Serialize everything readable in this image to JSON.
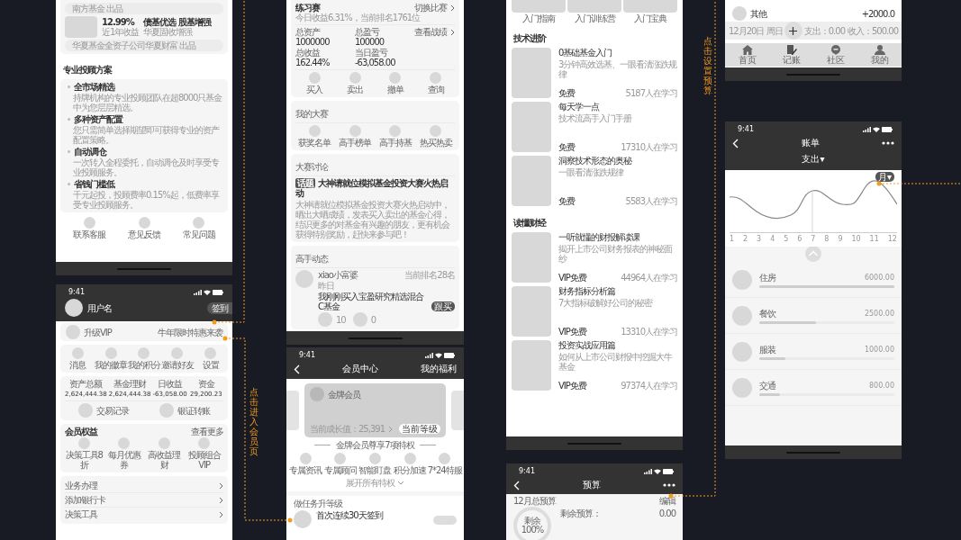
{
  "annotations": [
    {
      "text": "点击进入会员页"
    },
    {
      "text": "点击设置预算"
    }
  ],
  "fund_screen": {
    "issuer_top": "南方基金  出品",
    "fund": {
      "return": "12.99%",
      "return_label": "近1年收益",
      "name": "债基优选 股基增强",
      "subtitle": "华夏固收增强",
      "issuer": "华夏基金全资子公司华夏财富  出品"
    },
    "section_title": "专业投顾方案",
    "plans": [
      {
        "title": "全市场精选",
        "desc": "持牌机构的专业投顾团队在超8000只基金中为您层层精选。"
      },
      {
        "title": "多种资产配置",
        "desc": "您只需简单选择期望即可获得专业的资产配置策略。"
      },
      {
        "title": "自动调仓",
        "desc": "一次转入全程委托，自动调仓及时享受专业投顾服务。"
      },
      {
        "title": "省钱门槛低",
        "desc": "千元起投，投顾费率0.15%起，低费率享受专业投顾服务。"
      }
    ],
    "actions": [
      "联系客服",
      "意见反馈",
      "常见问题"
    ]
  },
  "profile_screen": {
    "time": "9:41",
    "username": "用户名",
    "sign_in": "签到",
    "vip": {
      "label": "升级VIP",
      "promo": "牛年限时特惠来袭"
    },
    "shortcuts": [
      "消息",
      "我的徽章",
      "我的积分",
      "邀请好友",
      "设置"
    ],
    "stats": [
      {
        "label": "资产总额",
        "value": "2,624,444.38"
      },
      {
        "label": "基金理财",
        "value": "2,624,444.38"
      },
      {
        "label": "日收益",
        "value": "-63,058.00"
      },
      {
        "label": "资金",
        "value": "29,200.23"
      }
    ],
    "links": [
      "交易记录",
      "银证转账"
    ],
    "benefits": {
      "title": "会员权益",
      "more": "查看更多",
      "items": [
        "决策工具8折",
        "每月优惠券",
        "高收益理财",
        "投顾组合VIP"
      ]
    },
    "menu": [
      "业务办理",
      "添加银行卡",
      "决策工具"
    ]
  },
  "contest_screen": {
    "title": "练习赛",
    "summary": "今日收益6.31%，当前排名1761位",
    "switch": "切换比赛",
    "records_link": "查看战绩",
    "stats": [
      {
        "label": "总资产",
        "value": "1000000"
      },
      {
        "label": "总盈亏",
        "value": "100000"
      },
      {
        "label": "总收益",
        "value": "162.44%"
      },
      {
        "label": "当日盈亏",
        "value": "-63,058.00"
      }
    ],
    "actions": [
      "买入",
      "卖出",
      "撤单",
      "查询"
    ],
    "my_contests": {
      "title": "我的大赛",
      "items": [
        "获奖名单",
        "高手榜单",
        "高手持基",
        "热买热卖"
      ]
    },
    "discussion": {
      "title": "大赛讨论",
      "tag": "话题",
      "headline": "大神请就位模拟基金投资大赛火热启动",
      "body": "大神请就位模拟基金投资大赛火热启动中，晒出大晒成绩，发表买入卖出的基金心得，结识更多的对基金有兴趣的朋友，更有机会获得特别奖励，赶快来参与吧！"
    },
    "feed": {
      "title": "高手动态",
      "user": "xiao小富婆",
      "rank": "当前排名28名",
      "time": "昨日",
      "post": "我刚刚买入宝盈研究精选混合C基金",
      "badge": "跟买",
      "likes": "10",
      "comments": "0"
    }
  },
  "member_screen": {
    "time": "9:41",
    "title": "会员中心",
    "action": "我的福利",
    "card": {
      "level": "金牌会员",
      "growth": "当前成长值：25,391",
      "badge": "当前等级"
    },
    "privileges_title": "金牌会员尊享7项特权",
    "privileges": [
      "专属资讯",
      "专属顾问",
      "智能盯盘",
      "积分加速",
      "7*24特服"
    ],
    "expand": "展开所有特权",
    "task_section": "做任务升等级",
    "task": "首次连续30天签到"
  },
  "courses_screen": {
    "guides": [
      "入门指南",
      "入门训练营",
      "入门宝典"
    ],
    "sections": [
      {
        "title": "技术进阶",
        "courses": [
          {
            "title": "0基础基金入门",
            "desc": "3分钟高效选基、一眼看清涨跌规律",
            "price": "免费",
            "learners": "5187人在学习"
          },
          {
            "title": "每天学一点",
            "desc": "技术流高手入门手册",
            "price": "免费",
            "learners": "17310人在学习"
          },
          {
            "title": "洞察技术形态的奥秘",
            "desc": "一眼看清涨跌规律",
            "price": "免费",
            "learners": "5583人在学习"
          }
        ]
      },
      {
        "title": "读懂财经",
        "courses": [
          {
            "title": "一听就懂的财报解读课",
            "desc": "揭开上市公司财务报表的神秘面纱",
            "price": "VIP免费",
            "learners": "44964人在学习"
          },
          {
            "title": "财务指标分析篇",
            "desc": "7大指标破解好公司的秘密",
            "price": "VIP免费",
            "learners": "13310人在学习"
          },
          {
            "title": "投资实战应用篇",
            "desc": "如何从上市公司财报中挖掘大牛基金",
            "price": "VIP免费",
            "learners": "97374人在学习"
          }
        ]
      }
    ]
  },
  "budget_screen": {
    "time": "9:41",
    "title": "预算",
    "month_label": "12月总预算",
    "edit": "编辑",
    "ring_label": "剩余",
    "ring_value": "100%",
    "remaining_label": "剩余预算：",
    "remaining": "0.00"
  },
  "ledger_screen": {
    "entries": [
      {
        "name": "其他",
        "amount": "+2000.0"
      }
    ],
    "day": {
      "date": "12月20日  周日",
      "expense": "支出：0.00",
      "income": "收入：500.00"
    },
    "tabs": [
      "首页",
      "记账",
      "社区",
      "我的"
    ]
  },
  "bill_screen": {
    "time": "9:41",
    "title": "账单",
    "filter": "支出▾",
    "marker": "月▾",
    "months": [
      "1",
      "2",
      "3",
      "4",
      "5",
      "6",
      "7",
      "8",
      "9",
      "10",
      "11",
      "12"
    ],
    "categories": [
      {
        "name": "住房",
        "amount": "6000.00",
        "level": 1
      },
      {
        "name": "餐饮",
        "amount": "2500.00",
        "level": 0.42
      },
      {
        "name": "服装",
        "amount": "1000.00",
        "level": 0.19
      },
      {
        "name": "交通",
        "amount": "800.00",
        "level": 0.15
      }
    ]
  }
}
